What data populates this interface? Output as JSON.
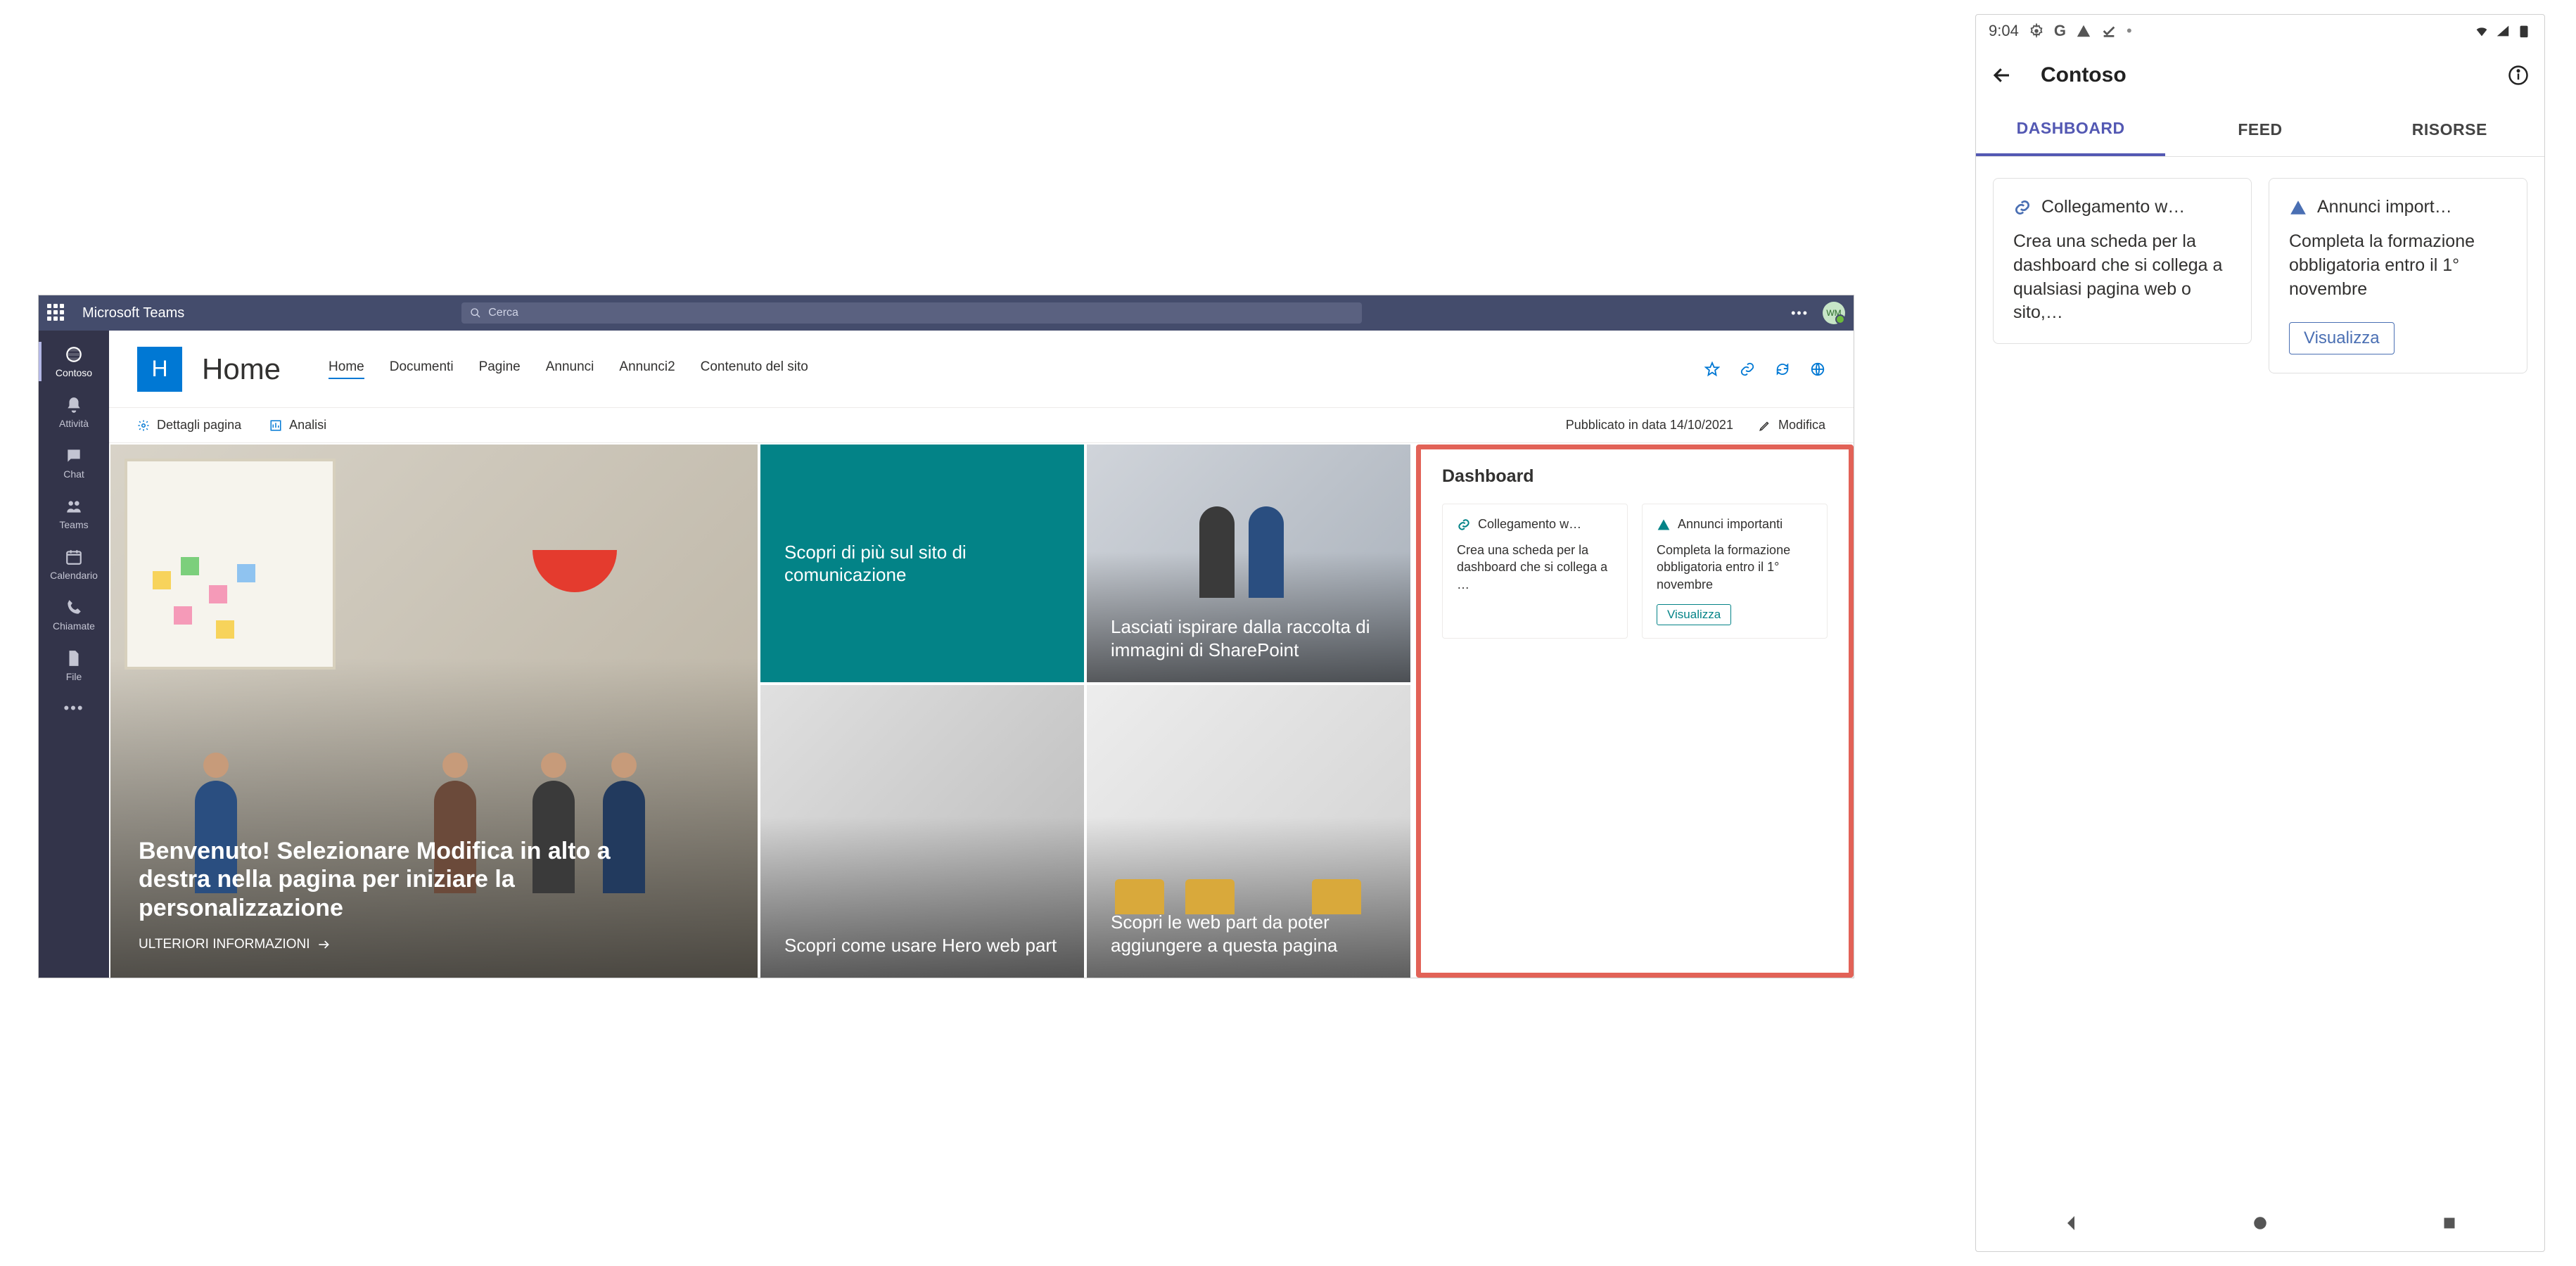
{
  "teams": {
    "app_title": "Microsoft Teams",
    "search_placeholder": "Cerca",
    "avatar_initials": "WM",
    "rail": [
      {
        "label": "Contoso"
      },
      {
        "label": "Attività"
      },
      {
        "label": "Chat"
      },
      {
        "label": "Teams"
      },
      {
        "label": "Calendario"
      },
      {
        "label": "Chiamate"
      },
      {
        "label": "File"
      }
    ],
    "site": {
      "logo_letter": "H",
      "title": "Home"
    },
    "tabs": [
      {
        "label": "Home",
        "active": true
      },
      {
        "label": "Documenti"
      },
      {
        "label": "Pagine"
      },
      {
        "label": "Annunci"
      },
      {
        "label": "Annunci2"
      },
      {
        "label": "Contenuto del sito"
      }
    ],
    "info_bar": {
      "details": "Dettagli pagina",
      "analytics": "Analisi",
      "published": "Pubblicato in data 14/10/2021",
      "edit": "Modifica"
    },
    "hero": {
      "main_title": "Benvenuto! Selezionare Modifica in alto a destra nella pagina per iniziare la personalizzazione",
      "main_link": "ULTERIORI INFORMAZIONI",
      "tile_teal": "Scopri di più sul sito di comunicazione",
      "tile_2": "Lasciati ispirare dalla raccolta di immagini di SharePoint",
      "tile_3": "Scopri come usare Hero web part",
      "tile_4": "Scopri le web part da poter aggiungere a questa pagina"
    },
    "dashboard": {
      "title": "Dashboard",
      "card1_title": "Collegamento w…",
      "card1_body": "Crea una scheda per la dashboard che si collega a …",
      "card2_title": "Annunci importanti",
      "card2_body": "Completa la formazione obbligatoria entro il 1° novembre",
      "card2_btn": "Visualizza"
    }
  },
  "phone": {
    "clock": "9:04",
    "title": "Contoso",
    "tabs": [
      {
        "label": "DASHBOARD",
        "active": true
      },
      {
        "label": "FEED"
      },
      {
        "label": "RISORSE"
      }
    ],
    "card1_title": "Collegamento w…",
    "card1_body": "Crea una scheda per la dashboard che si collega a qualsiasi pagina web o sito,…",
    "card2_title": "Annunci import…",
    "card2_body": "Completa la formazione obbligatoria entro il 1° novembre",
    "card2_btn": "Visualizza"
  }
}
